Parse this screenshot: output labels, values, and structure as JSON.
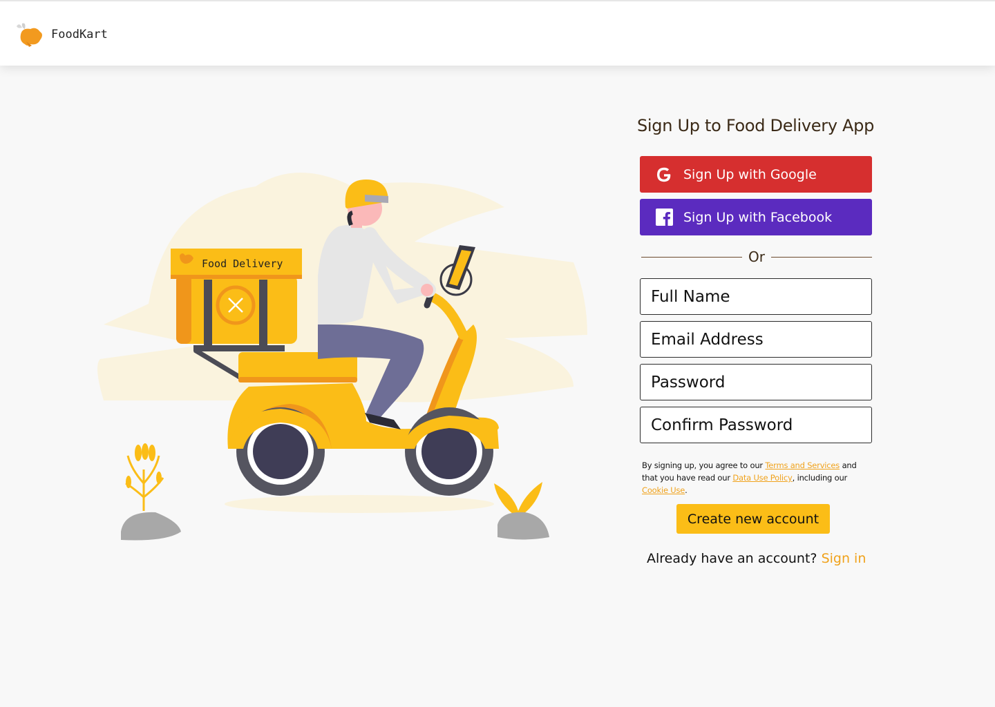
{
  "header": {
    "brand_name": "FoodKart",
    "logo_icon": "food-bowl-icon"
  },
  "illustration": {
    "box_label": "Food Delivery",
    "colors": {
      "yellow": "#fbbd17",
      "orange": "#f0961b",
      "dark": "#4b4b55",
      "purple": "#6e6e96",
      "cream": "#faf3de"
    }
  },
  "form": {
    "title": "Sign Up to Food Delivery App",
    "google_label": "Sign Up with Google",
    "facebook_label": "Sign Up with Facebook",
    "divider_text": "Or",
    "full_name_placeholder": "Full Name",
    "email_placeholder": "Email Address",
    "password_placeholder": "Password",
    "confirm_password_placeholder": "Confirm Password",
    "terms": {
      "prefix": "By signing up, you agree to our ",
      "terms_link": "Terms and Services",
      "middle": " and that you have read our ",
      "data_link": "Data Use Policy",
      "middle2": ", including our ",
      "cookie_link": "Cookie Use",
      "suffix": "."
    },
    "create_label": "Create new account",
    "signin_prompt": "Already have an account? ",
    "signin_link": "Sign in"
  },
  "colors": {
    "google": "#d62f2f",
    "facebook": "#5b2bbf",
    "accent": "#fbbd17",
    "link": "#f0a21b"
  }
}
